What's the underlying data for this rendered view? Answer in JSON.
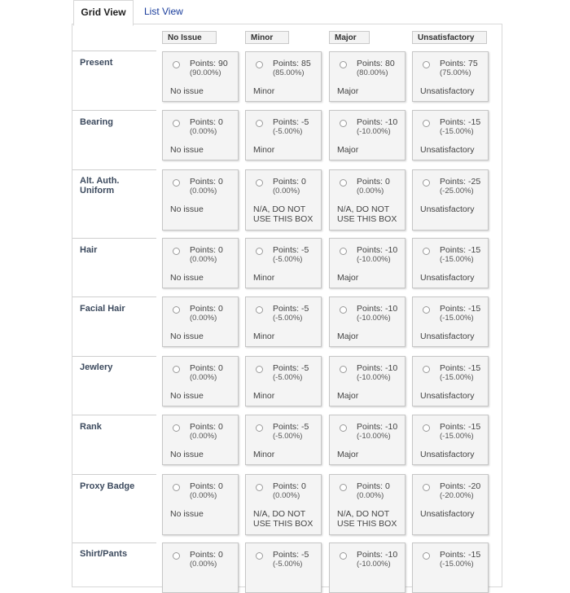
{
  "tabs": [
    {
      "label": "Grid View",
      "active": true
    },
    {
      "label": "List View",
      "active": false
    }
  ],
  "columns": [
    "No Issue",
    "Minor",
    "Major",
    "Unsatisfactory"
  ],
  "rows": [
    {
      "label": "Present",
      "cells": [
        {
          "points": "Points: 90",
          "percent": "(90.00%)",
          "label": "No issue"
        },
        {
          "points": "Points: 85",
          "percent": "(85.00%)",
          "label": "Minor"
        },
        {
          "points": "Points: 80",
          "percent": "(80.00%)",
          "label": "Major"
        },
        {
          "points": "Points: 75",
          "percent": "(75.00%)",
          "label": "Unsatisfactory"
        }
      ]
    },
    {
      "label": "Bearing",
      "cells": [
        {
          "points": "Points: 0",
          "percent": "(0.00%)",
          "label": "No issue"
        },
        {
          "points": "Points: -5",
          "percent": "(-5.00%)",
          "label": "Minor"
        },
        {
          "points": "Points: -10",
          "percent": "(-10.00%)",
          "label": "Major"
        },
        {
          "points": "Points: -15",
          "percent": "(-15.00%)",
          "label": "Unsatisfactory"
        }
      ]
    },
    {
      "label": "Alt. Auth. Uniform",
      "cells": [
        {
          "points": "Points: 0",
          "percent": "(0.00%)",
          "label": "No issue"
        },
        {
          "points": "Points: 0",
          "percent": "(0.00%)",
          "label": "N/A, DO NOT USE THIS BOX"
        },
        {
          "points": "Points: 0",
          "percent": "(0.00%)",
          "label": "N/A, DO NOT USE THIS BOX"
        },
        {
          "points": "Points: -25",
          "percent": "(-25.00%)",
          "label": "Unsatisfactory"
        }
      ]
    },
    {
      "label": "Hair",
      "cells": [
        {
          "points": "Points: 0",
          "percent": "(0.00%)",
          "label": "No issue"
        },
        {
          "points": "Points: -5",
          "percent": "(-5.00%)",
          "label": "Minor"
        },
        {
          "points": "Points: -10",
          "percent": "(-10.00%)",
          "label": "Major"
        },
        {
          "points": "Points: -15",
          "percent": "(-15.00%)",
          "label": "Unsatisfactory"
        }
      ]
    },
    {
      "label": "Facial Hair",
      "cells": [
        {
          "points": "Points: 0",
          "percent": "(0.00%)",
          "label": "No issue"
        },
        {
          "points": "Points: -5",
          "percent": "(-5.00%)",
          "label": "Minor"
        },
        {
          "points": "Points: -10",
          "percent": "(-10.00%)",
          "label": "Major"
        },
        {
          "points": "Points: -15",
          "percent": "(-15.00%)",
          "label": "Unsatisfactory"
        }
      ]
    },
    {
      "label": "Jewlery",
      "cells": [
        {
          "points": "Points: 0",
          "percent": "(0.00%)",
          "label": "No issue"
        },
        {
          "points": "Points: -5",
          "percent": "(-5.00%)",
          "label": "Minor"
        },
        {
          "points": "Points: -10",
          "percent": "(-10.00%)",
          "label": "Major"
        },
        {
          "points": "Points: -15",
          "percent": "(-15.00%)",
          "label": "Unsatisfactory"
        }
      ]
    },
    {
      "label": "Rank",
      "cells": [
        {
          "points": "Points: 0",
          "percent": "(0.00%)",
          "label": "No issue"
        },
        {
          "points": "Points: -5",
          "percent": "(-5.00%)",
          "label": "Minor"
        },
        {
          "points": "Points: -10",
          "percent": "(-10.00%)",
          "label": "Major"
        },
        {
          "points": "Points: -15",
          "percent": "(-15.00%)",
          "label": "Unsatisfactory"
        }
      ]
    },
    {
      "label": "Proxy Badge",
      "cells": [
        {
          "points": "Points: 0",
          "percent": "(0.00%)",
          "label": "No issue"
        },
        {
          "points": "Points: 0",
          "percent": "(0.00%)",
          "label": "N/A, DO NOT USE THIS BOX"
        },
        {
          "points": "Points: 0",
          "percent": "(0.00%)",
          "label": "N/A, DO NOT USE THIS BOX"
        },
        {
          "points": "Points: -20",
          "percent": "(-20.00%)",
          "label": "Unsatisfactory"
        }
      ]
    },
    {
      "label": "Shirt/Pants",
      "cells": [
        {
          "points": "Points: 0",
          "percent": "(0.00%)",
          "label": ""
        },
        {
          "points": "Points: -5",
          "percent": "(-5.00%)",
          "label": ""
        },
        {
          "points": "Points: -10",
          "percent": "(-10.00%)",
          "label": ""
        },
        {
          "points": "Points: -15",
          "percent": "(-15.00%)",
          "label": ""
        }
      ]
    }
  ]
}
